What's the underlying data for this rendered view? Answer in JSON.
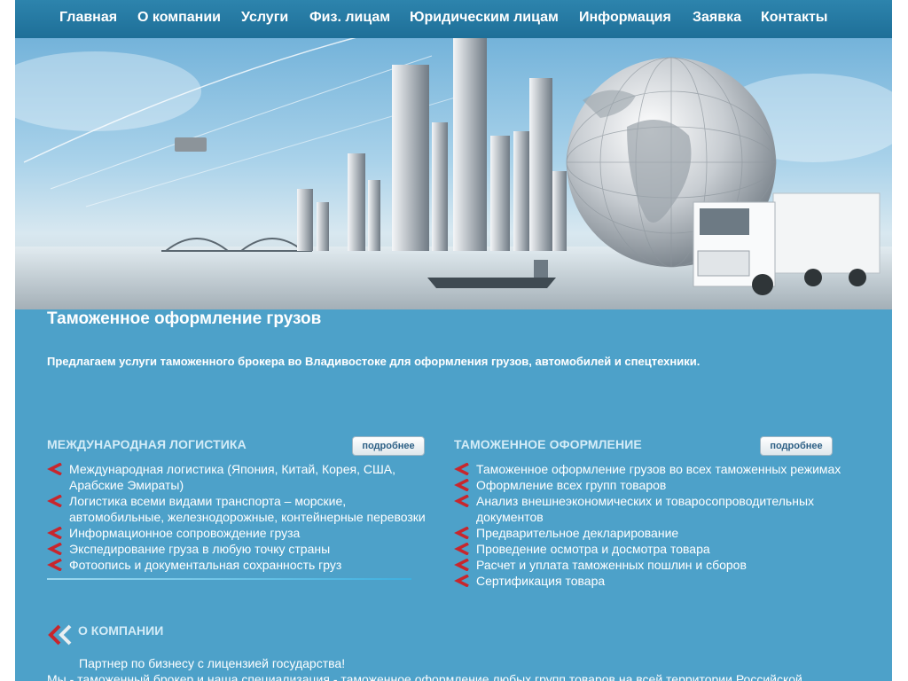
{
  "nav": {
    "items": [
      {
        "label": "Главная"
      },
      {
        "label": "О компании"
      },
      {
        "label": "Услуги"
      },
      {
        "label": "Физ. лицам"
      },
      {
        "label": "Юридическим лицам"
      },
      {
        "label": "Информация"
      },
      {
        "label": "Заявка"
      },
      {
        "label": "Контакты"
      }
    ]
  },
  "page_title": "Таможенное оформление грузов",
  "intro": "Предлагаем услуги таможенного брокера во Владивостоке для оформления грузов, автомобилей и спецтехники.",
  "logistics": {
    "title": "МЕЖДУНАРОДНАЯ ЛОГИСТИКА",
    "more_label": "подробнее",
    "items": [
      "Международная логистика (Япония, Китай, Корея, США, Арабские Эмираты)",
      "Логистика всеми видами транспорта – морские, автомобильные, железнодорожные, контейнерные перевозки",
      "Информационное сопровождение груза",
      "Экспедирование груза в любую точку страны",
      "Фотоопись и документальная сохранность груз"
    ]
  },
  "customs": {
    "title": "ТАМОЖЕННОЕ ОФОРМЛЕНИЕ",
    "more_label": "подробнее",
    "items": [
      "Таможенное оформление грузов во всех таможенных режимах",
      "Оформление всех групп товаров",
      "Анализ внешнеэкономических и товаросопроводительных документов",
      "Предварительное декларирование",
      "Проведение осмотра и досмотра товара",
      "Расчет и уплата таможенных пошлин и сборов",
      "Сертификация товара"
    ]
  },
  "about": {
    "title": "О КОМПАНИИ",
    "line1": "Партнер по бизнесу с лицензией государства!",
    "line2": "Мы - таможенный брокер и наша специализация - таможенное оформление любых групп товаров на всей территории Российской"
  },
  "colors": {
    "background": "#4da1c9",
    "nav": "#1e6f98",
    "accent_red": "#c8262d"
  },
  "icons": {
    "bullet": "red-arrow-icon",
    "about": "double-chevron-icon"
  }
}
